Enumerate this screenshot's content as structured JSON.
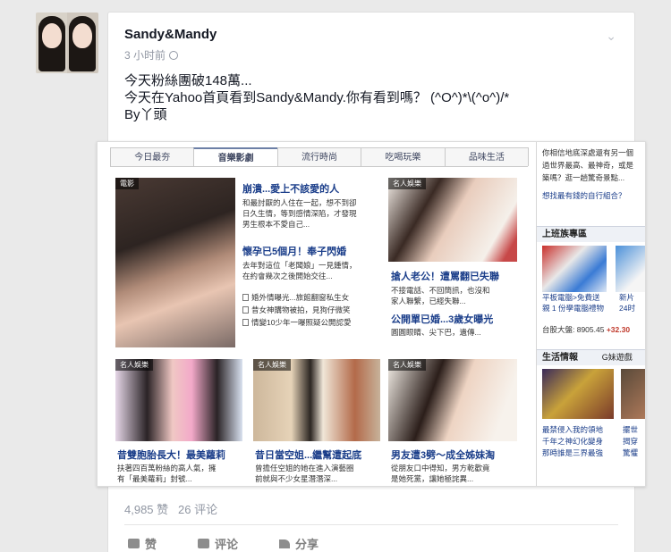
{
  "post": {
    "author": "Sandy&Mandy",
    "time": "3 小时前",
    "lines": [
      "今天粉絲團破148萬...",
      "今天在Yahoo首頁看到Sandy&Mandy.你有看到嗎？ (^O^)*\\(^o^)/*",
      "By丫頭"
    ],
    "stats": {
      "likes": "4,985 赞",
      "comments": "26 评论"
    },
    "actions": {
      "like": "赞",
      "comment": "评论",
      "share": "分享"
    }
  },
  "yahoo": {
    "tabs": [
      "今日最夯",
      "音樂影劇",
      "流行時尚",
      "吃喝玩樂",
      "品味生活"
    ],
    "feature": {
      "caption": "電影",
      "headline": "崩潰...愛上不該愛的人",
      "snippet": [
        "和最討厭的人住在一起，想不到卻",
        "日久生情，等到感情深陷，才發現",
        "男生根本不愛自己..."
      ],
      "headline2": "懷孕已5個月！奉子閃婚",
      "snippet2": [
        "去年對這位「老闆娘」一見鍾情，",
        "在約會幾次之後開始交往..."
      ],
      "bullets": [
        "婚外情曝光...旅館翻窗私生女",
        "昔女神購物被拍，見狗仔微笑",
        "情變10少年一曝照疑公開認愛"
      ]
    },
    "side_story": {
      "caption": "名人娛樂",
      "headline": "搶人老公！遭罵翻已失聯",
      "snippet": [
        "不接電話、不回簡訊，也沒和",
        "家人聯繫，已經失聯..."
      ],
      "headline2": "公開單已婚...3歲女曝光",
      "snippet2": [
        "圓圓眼睛、尖下巴，遺傳..."
      ]
    },
    "bottom": [
      {
        "caption": "名人娛樂",
        "headline": "昔雙胞胎長大！最美蘿莉",
        "snippet": [
          "扶著四百萬粉絲的高人氣，擁",
          "有「最美蘿莉」封號..."
        ]
      },
      {
        "caption": "名人娛樂",
        "headline": "昔日當空姐...繼幫遭起底",
        "snippet": [
          "曾擔任空姐的她在進入演藝圈",
          "前就與不少女星潛潛深..."
        ]
      },
      {
        "caption": "名人娛樂",
        "headline": "男友遭3劈～成全姊妹淘",
        "snippet": [
          "從朋友口中得知，男方乾歡竟",
          "是她死黨，讓她極詫異..."
        ]
      }
    ],
    "right": {
      "top_lines": [
        "你相信地底深處還有另一個",
        "過世界最高、最神奇，或是",
        "築嗎？逛一趟驚奇景點...",
        "想找最有錢的自行組合？"
      ],
      "office_header": "上班族專區",
      "office_items": [
        "平板電腦>免費送",
        "親 1 份學電腦禮物",
        "新片",
        "24时"
      ],
      "stock": "台股大盤: 8905.45",
      "stock_change": "+32.30",
      "news_header": "生活情報",
      "news_tab2": "G妹遊戲",
      "news_items": [
        "最禁侵入我的領地",
        "千年之神幻化變身",
        "那時誰是三界最強",
        "擺世",
        "揭穿",
        "驚懼"
      ]
    }
  },
  "colors": {
    "link": "#1b3e8a",
    "stock_up": "#c0392b"
  }
}
